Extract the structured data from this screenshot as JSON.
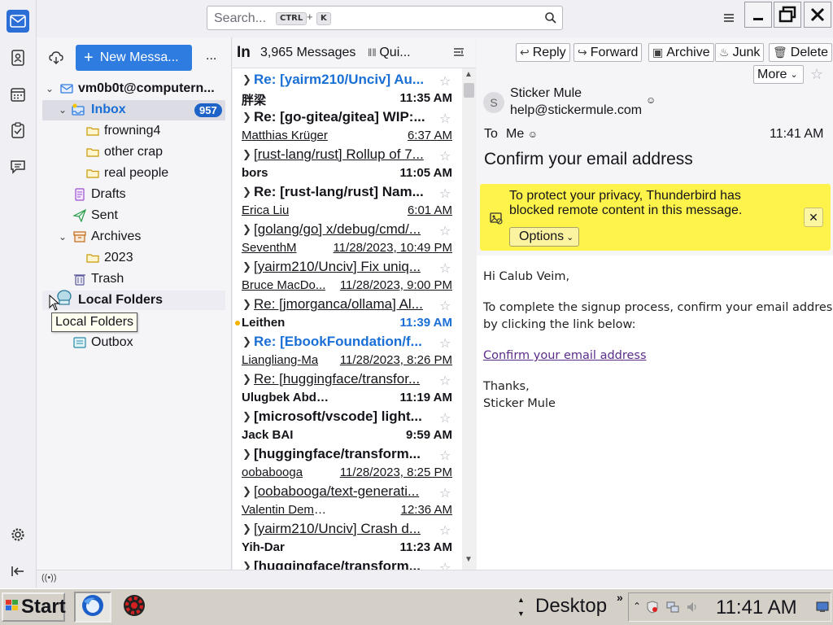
{
  "search": {
    "placeholder": "Search...",
    "shortcut_ctrl": "CTRL",
    "shortcut_plus": "+",
    "shortcut_key": "K"
  },
  "folder_pane": {
    "new_message_label": "New Messa...",
    "more_label": "...",
    "account": "vm0b0t@computern...",
    "inbox_label": "Inbox",
    "inbox_unread": "957",
    "folders": {
      "frowning4": "frowning4",
      "other_crap": "other crap",
      "real_people": "real people",
      "drafts": "Drafts",
      "sent": "Sent",
      "archives": "Archives",
      "year_2023": "2023",
      "trash": "Trash",
      "local_folders": "Local Folders",
      "outbox": "Outbox"
    },
    "tooltip": "Local Folders"
  },
  "message_list": {
    "title_initial": "In",
    "count": "3,965 Messages",
    "quick_filter": "Qui...",
    "messages": [
      {
        "subject": "Re: [yairm210/Unciv] Au...",
        "from": "胖梁",
        "date": "11:35 AM"
      },
      {
        "subject": "Re: [go-gitea/gitea] WIP:...",
        "from": "Matthias Krüger",
        "date": "6:37 AM"
      },
      {
        "subject": "[rust-lang/rust] Rollup of 7...",
        "from": "bors",
        "date": "11:05 AM"
      },
      {
        "subject": "Re: [rust-lang/rust] Nam...",
        "from": "Erica Liu",
        "date": "6:01 AM"
      },
      {
        "subject": "[golang/go] x/debug/cmd/...",
        "from": "SeventhM",
        "date": "11/28/2023, 10:49 PM"
      },
      {
        "subject": "[yairm210/Unciv] Fix uniq...",
        "from": "Bruce MacDo...",
        "date": "11/28/2023, 9:00 PM"
      },
      {
        "subject": "Re: [jmorganca/ollama] Al...",
        "from": "Leithen",
        "date": "11:39 AM"
      },
      {
        "subject": "Re: [EbookFoundation/f...",
        "from": "Liangliang-Ma",
        "date": "11/28/2023, 8:26 PM"
      },
      {
        "subject": "Re: [huggingface/transfor...",
        "from": "Ulugbek Abdullaev",
        "date": "11:19 AM"
      },
      {
        "subject": "[microsoft/vscode] light...",
        "from": "Jack BAI",
        "date": "9:59 AM"
      },
      {
        "subject": "[huggingface/transform...",
        "from": "oobabooga",
        "date": "11/28/2023, 8:25 PM"
      },
      {
        "subject": "[oobabooga/text-generati...",
        "from": "Valentin Demeusy",
        "date": "12:36 AM"
      },
      {
        "subject": "[yairm210/Unciv] Crash d...",
        "from": "Yih-Dar",
        "date": "11:23 AM"
      },
      {
        "subject": "[huggingface/transform...",
        "from": "",
        "date": ""
      }
    ]
  },
  "reading_pane": {
    "buttons": {
      "reply": "Reply",
      "forward": "Forward",
      "archive": "Archive",
      "junk": "Junk",
      "delete": "Delete",
      "more": "More"
    },
    "avatar_letter": "S",
    "sender_name": "Sticker Mule",
    "sender_email": "help@stickermule.com",
    "to_label": "To",
    "to_value": "Me",
    "time": "11:41 AM",
    "subject": "Confirm your email address",
    "notice_line1": "To protect your privacy, Thunderbird has",
    "notice_line2": "blocked remote content in this message.",
    "options_label": "Options",
    "body": {
      "greeting": "Hi Calub Veim,",
      "line1": "To complete the signup process, confirm your email address",
      "line2": "by clicking the link below:",
      "link": "Confirm your email address",
      "thanks": "Thanks,",
      "signature": "Sticker Mule"
    }
  },
  "taskbar": {
    "start_label": "Start",
    "desktop_label": "Desktop",
    "desktop_chevron": "»",
    "clock": "11:41 AM"
  },
  "colors": {
    "accent": "#2f7ce0",
    "badge": "#1e63c8",
    "unread_blue": "#1a6fd6",
    "notice_yellow": "#fdf34b"
  }
}
